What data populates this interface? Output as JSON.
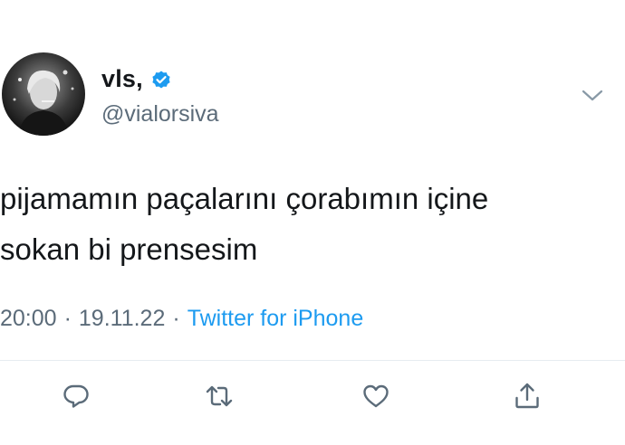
{
  "user": {
    "display_name": "vls,",
    "handle": "@vialorsiva",
    "verified": true,
    "avatar_icon": "profile-photo"
  },
  "tweet": {
    "text": "pijamamın paçalarını çorabımın içine\nsokan bi prensesim",
    "time": "20:00",
    "date": "19.11.22",
    "separator": "·",
    "source": "Twitter for iPhone"
  },
  "actions": {
    "reply_icon": "reply-icon",
    "retweet_icon": "retweet-icon",
    "like_icon": "heart-icon",
    "share_icon": "share-icon"
  },
  "colors": {
    "text": "#14171a",
    "secondary": "#5b6b79",
    "link": "#1d9bf0",
    "verified": "#1d9bf0",
    "icon": "#5b6b79"
  }
}
